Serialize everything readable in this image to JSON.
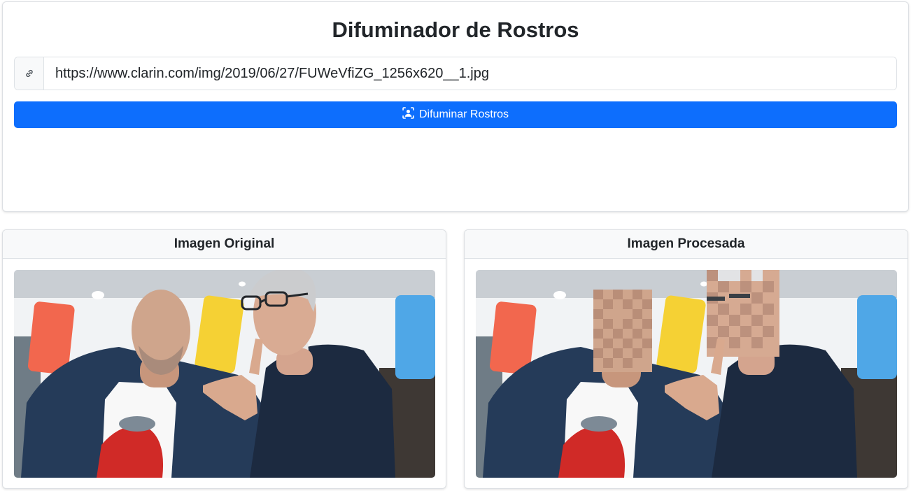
{
  "app": {
    "title": "Difuminador de Rostros"
  },
  "form": {
    "url_value": "https://www.clarin.com/img/2019/06/27/FUWeVfiZG_1256x620__1.jpg",
    "link_icon": "link-icon",
    "button_icon": "face-scan-icon",
    "button_label": "Difuminar Rostros"
  },
  "panels": {
    "original_title": "Imagen Original",
    "processed_title": "Imagen Procesada"
  },
  "colors": {
    "primary": "#0d6efd",
    "card_header_bg": "#f8f9fa",
    "border": "#dee2e6"
  }
}
